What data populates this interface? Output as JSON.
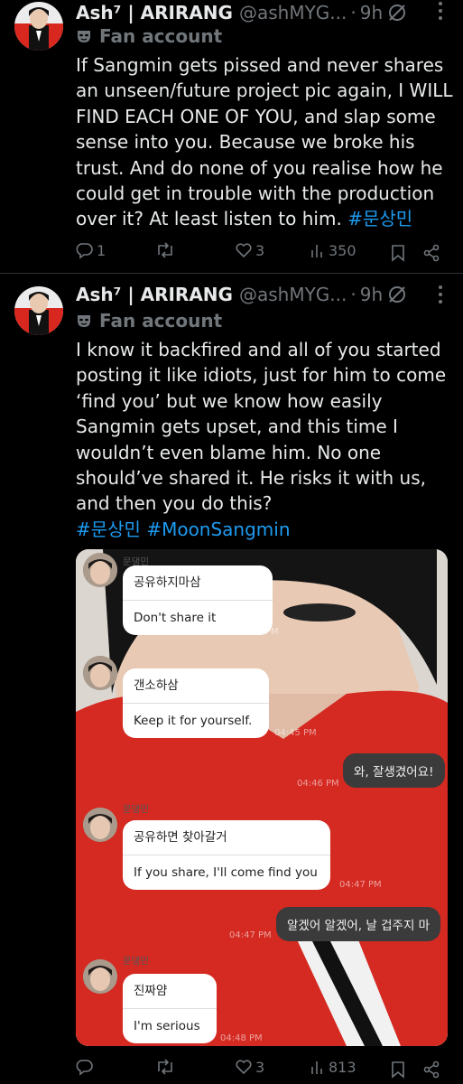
{
  "colors": {
    "bg": "#000000",
    "text": "#e7e9ea",
    "muted": "#71767b",
    "link": "#1d9bf0",
    "divider": "#2f3336"
  },
  "tweet1": {
    "name": "Ash⁷ | ARIRANG",
    "handle": "@ashMYG...",
    "dot": "·",
    "time": "9h",
    "badge": "Fan account",
    "text_lines": [
      "If Sangmin gets pissed and never shares",
      "an unseen/future project pic again, I WILL",
      "FIND EACH ONE OF YOU, and slap some",
      "sense into you. Because we broke his",
      "trust. And do none of you realise how he",
      "could get in trouble with the production",
      "over it? At least listen to him."
    ],
    "hashtag": "#문상민",
    "replies": "1",
    "likes": "3",
    "views": "350"
  },
  "tweet2": {
    "name": "Ash⁷ | ARIRANG",
    "handle": "@ashMYG...",
    "dot": "·",
    "time": "9h",
    "badge": "Fan account",
    "text_lines": [
      "I know it backfired and all of you started",
      "posting it like idiots, just for him to come",
      "‘find you’ but we know how easily",
      "Sangmin gets upset, and this time I",
      "wouldn’t even blame him. No one",
      "should’ve shared it. He risks it with us,",
      "and then you do this?"
    ],
    "hashtags": "#문상민 #MoonSangmin",
    "likes": "3",
    "views": "813",
    "chat": {
      "sender": "문댕민",
      "msgs": [
        {
          "ko": "공유하지마삼",
          "en": "Don't share it",
          "time": "04:45 PM"
        },
        {
          "ko": "갠소하삼",
          "en": "Keep it for yourself.",
          "time": "04:45 PM"
        },
        {
          "out": "와, 잘생겼어요!",
          "time": "04:46 PM"
        },
        {
          "ko": "공유하면 찾아갈거",
          "en": "If you share, I'll come find you",
          "time": "04:47 PM"
        },
        {
          "out": "알겠어 알겠어, 날 겁주지 마",
          "time": "04:47 PM"
        },
        {
          "ko": "진짜얌",
          "en": "I'm serious",
          "time": "04:48 PM"
        }
      ]
    }
  }
}
